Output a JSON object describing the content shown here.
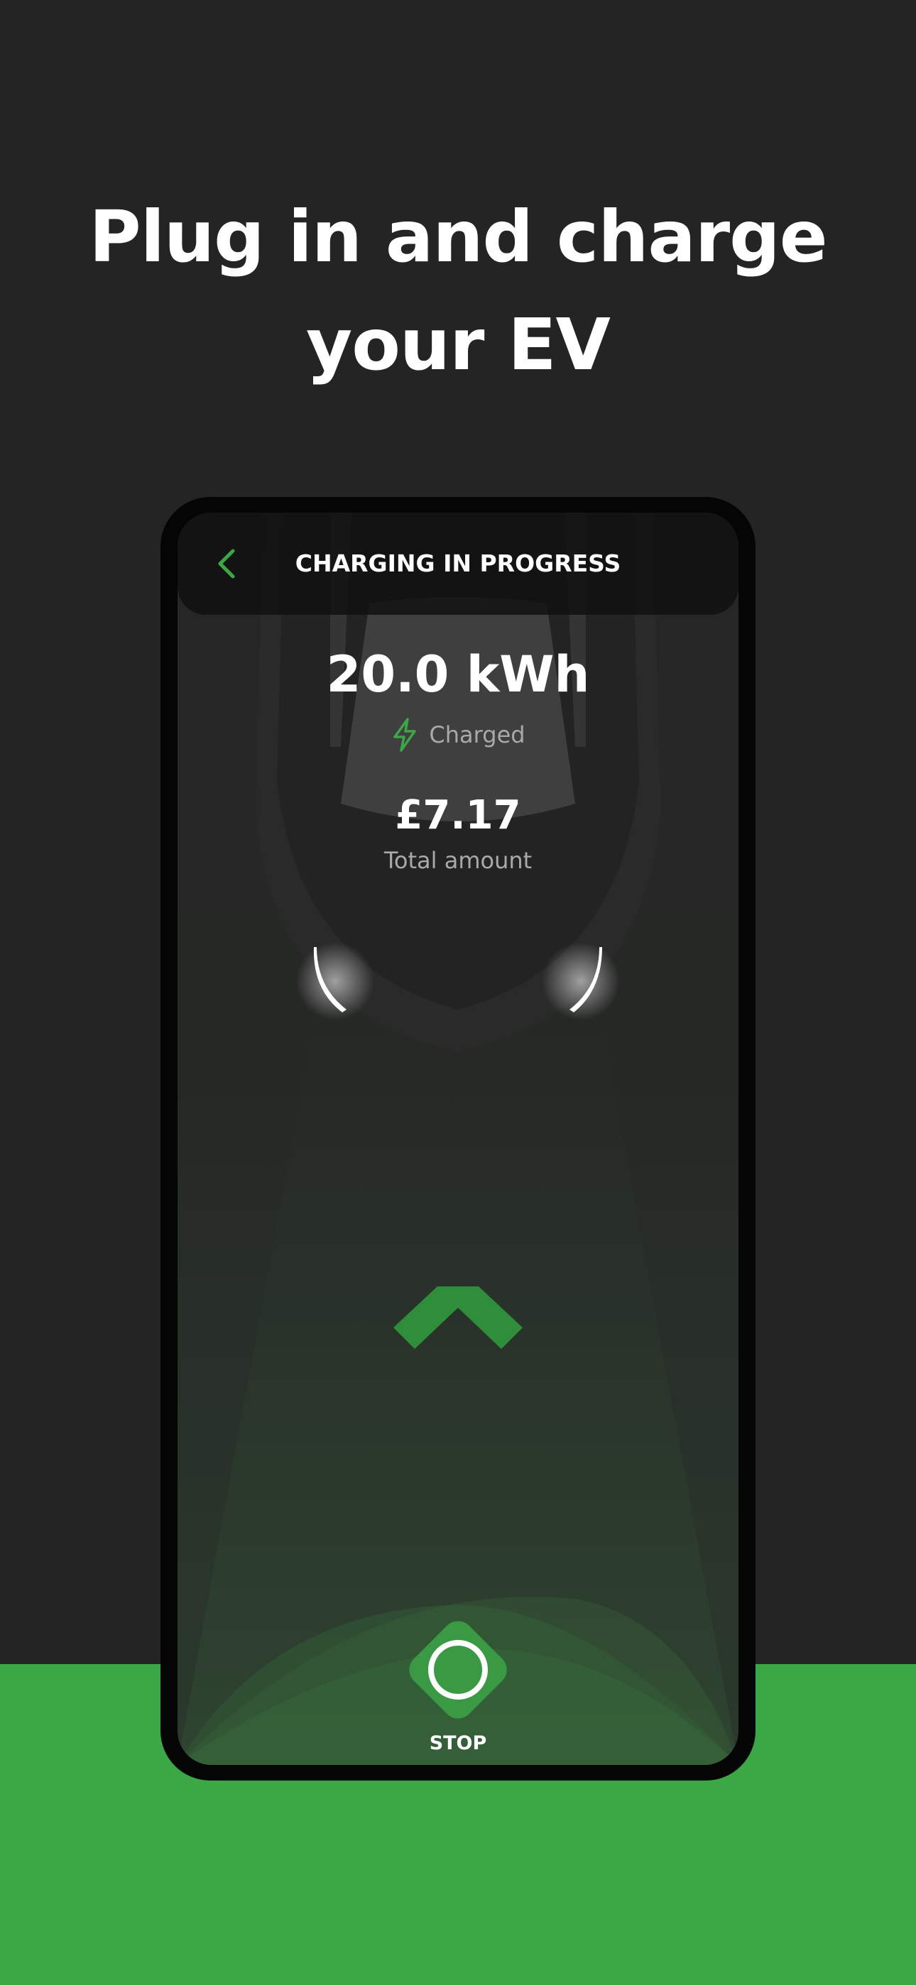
{
  "headline": {
    "line1": "Plug in and charge",
    "line2": "your EV"
  },
  "colors": {
    "background": "#242424",
    "accent_green": "#3aa845",
    "stop_green": "#3a9a44",
    "phone_frame": "#050505"
  },
  "screen": {
    "topbar": {
      "back_icon": "chevron-left-icon",
      "title": "CHARGING IN PROGRESS"
    },
    "energy": {
      "value": "20.0 kWh",
      "status_icon": "lightning-bolt-icon",
      "status_label": "Charged"
    },
    "cost": {
      "value": "£7.17",
      "label": "Total amount"
    },
    "swipe_icon": "chevron-up-icon",
    "stop": {
      "icon": "stop-circle-icon",
      "label": "STOP"
    }
  }
}
